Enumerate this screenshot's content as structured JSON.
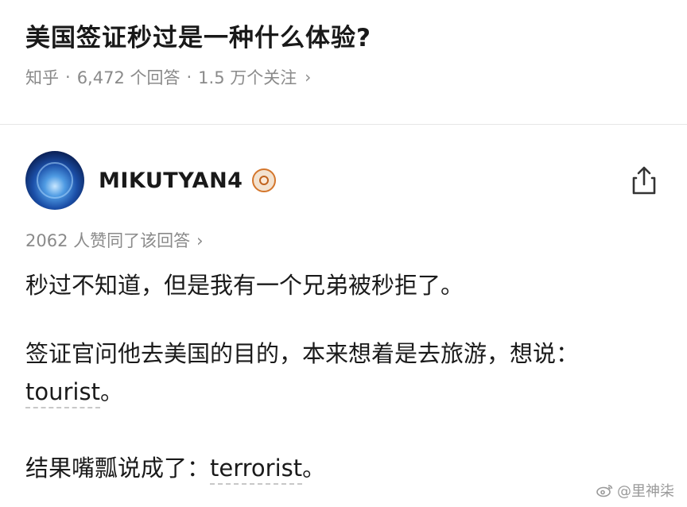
{
  "question": {
    "title": "美国签证秒过是一种什么体验?",
    "source": "知乎",
    "answers": "6,472 个回答",
    "followers": "1.5 万个关注",
    "chevron": "›"
  },
  "author": {
    "name": "MIKUTYAN4",
    "badge_icon": "eye-badge-icon",
    "share_icon": "share-icon"
  },
  "likes": {
    "text": "2062 人赞同了该回答",
    "chevron": "›"
  },
  "answer": {
    "p1": "秒过不知道，但是我有一个兄弟被秒拒了。",
    "p2_prefix": "签证官问他去美国的目的，本来想着是去旅游，想说：",
    "p2_word": "tourist",
    "p2_suffix": "。",
    "p3_prefix": "结果嘴瓢说成了：",
    "p3_word": "terrorist",
    "p3_suffix": "。"
  },
  "watermark": {
    "text": "@里神柒"
  },
  "colors": {
    "text": "#191919",
    "secondary": "#8a8a8a",
    "divider": "#e6e6e6",
    "badge_orange": "#d4762c"
  }
}
